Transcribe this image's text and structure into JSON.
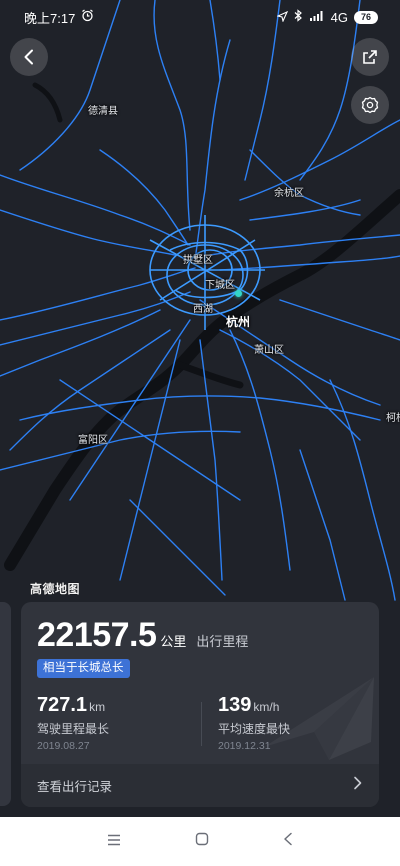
{
  "status_bar": {
    "time": "晚上7:17",
    "network": "4G",
    "battery": "76",
    "icons": [
      "alarm-icon",
      "location-arrow-icon",
      "bluetooth-icon",
      "hd-signal-icon",
      "signal-bars-icon",
      "battery-icon"
    ]
  },
  "header": {
    "back_icon": "chevron-left-icon",
    "share_icon": "share-external-icon",
    "settings_icon": "gear-icon"
  },
  "map": {
    "labels": {
      "deqing": "德清县",
      "yuhang": "余杭区",
      "gongshu": "拱墅区",
      "xiacheng": "下城区",
      "xihu": "西湖",
      "hangzhou": "杭州",
      "xiaoshan": "萧山区",
      "fuyang": "富阳区",
      "kequ": "柯桥"
    },
    "logo": "高德地图",
    "colors": {
      "background": "#1f2229",
      "roads": "#2e86ff",
      "water": "#101216",
      "city_dot": "#33d6c8"
    }
  },
  "summary_card": {
    "total_value": "22157.5",
    "total_unit": "公里",
    "total_label": "出行里程",
    "compare_badge": "相当于长城总长",
    "stats": [
      {
        "value": "727.1",
        "unit": "km",
        "label": "驾驶里程最长",
        "date": "2019.08.27"
      },
      {
        "value": "139",
        "unit": "km/h",
        "label": "平均速度最快",
        "date": "2019.12.31"
      }
    ],
    "record_link": "查看出行记录",
    "accent_color": "#3d72d6"
  },
  "nav_bar": {
    "icons": [
      "menu-icon",
      "home-square-icon",
      "back-triangle-icon"
    ]
  }
}
